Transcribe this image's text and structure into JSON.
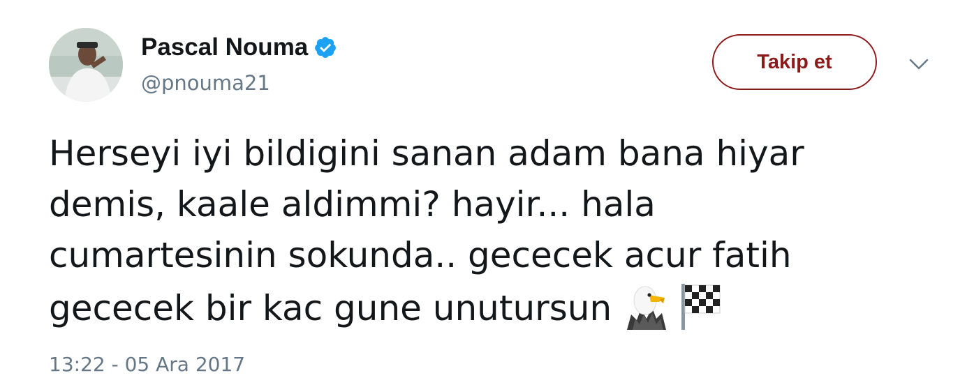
{
  "user": {
    "display_name": "Pascal Nouma",
    "handle": "@pnouma21",
    "verified": true,
    "avatar_icon": "profile-photo"
  },
  "header": {
    "follow_label": "Takip et",
    "menu_icon": "chevron-down-icon"
  },
  "tweet": {
    "lines": [
      "Herseyi iyi bildigini sanan adam bana hiyar",
      "demis, kaale aldimmi?  hayir... hala",
      "cumartesinin sokunda.. gececek acur fatih",
      "gececek bir kac gune unutursun"
    ],
    "emojis": [
      "eagle-emoji",
      "checkered-flag-emoji"
    ]
  },
  "meta": {
    "timestamp": "13:22 - 05 Ara 2017"
  },
  "colors": {
    "follow_accent": "#8b1a1a",
    "verified_blue": "#1da1f2",
    "secondary_text": "#657786",
    "primary_text": "#14171a"
  }
}
